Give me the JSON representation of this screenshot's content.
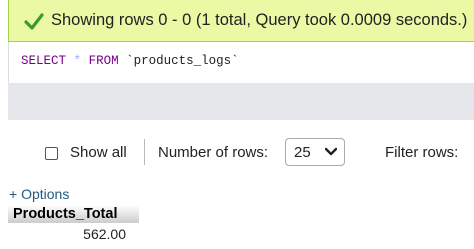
{
  "status": {
    "message": "Showing rows 0 - 0 (1 total, Query took 0.0009 seconds.)",
    "icon": "check-icon",
    "color": "#ebf8a4"
  },
  "sql": {
    "select": "SELECT",
    "star": "*",
    "from": "FROM",
    "table": "`products_logs`"
  },
  "controls": {
    "show_all_label": "Show all",
    "rows_label": "Number of rows:",
    "rows_value": "25",
    "filter_label": "Filter rows:"
  },
  "options_link": "+ Options",
  "table": {
    "columns": [
      "Products_Total"
    ],
    "rows": [
      [
        "562.00"
      ]
    ]
  }
}
